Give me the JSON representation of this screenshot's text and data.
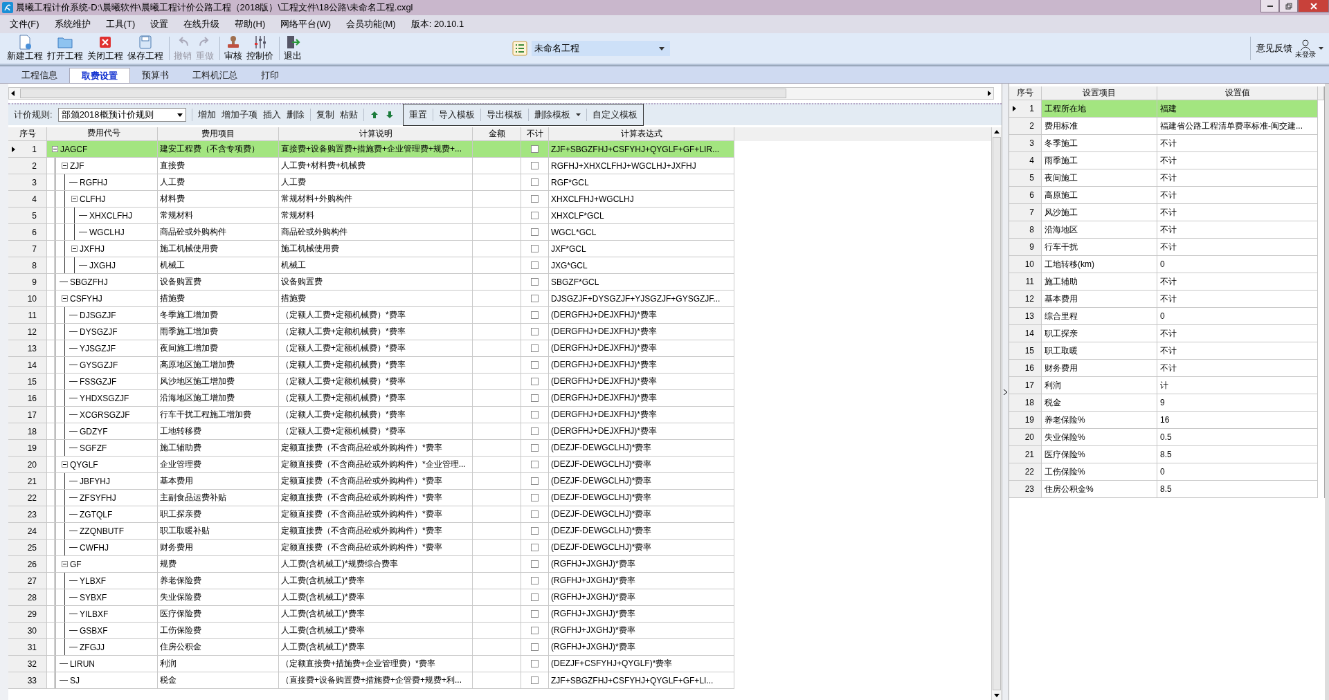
{
  "window": {
    "title": "晨曦工程计价系统-D:\\晨曦软件\\晨曦工程计价公路工程（2018版）\\工程文件\\18公路\\未命名工程.cxgl"
  },
  "menu": [
    "文件(F)",
    "系统维护",
    "工具(T)",
    "设置",
    "在线升级",
    "帮助(H)",
    "网络平台(W)",
    "会员功能(M)",
    "版本: 20.10.1"
  ],
  "toolbar": [
    {
      "label": "新建工程",
      "disabled": false
    },
    {
      "label": "打开工程",
      "disabled": false
    },
    {
      "label": "关闭工程",
      "disabled": false
    },
    {
      "label": "保存工程",
      "disabled": false
    },
    {
      "label": "撤销",
      "disabled": true
    },
    {
      "label": "重做",
      "disabled": true
    },
    {
      "label": "审核",
      "disabled": false
    },
    {
      "label": "控制价",
      "disabled": false
    },
    {
      "label": "退出",
      "disabled": false
    }
  ],
  "project_selector": {
    "value": "未命名工程"
  },
  "feedback": "意见反馈",
  "user": "未登录",
  "tabs": [
    {
      "label": "工程信息",
      "selected": false
    },
    {
      "label": "取费设置",
      "selected": true
    },
    {
      "label": "预算书",
      "selected": false
    },
    {
      "label": "工料机汇总",
      "selected": false
    },
    {
      "label": "打印",
      "selected": false
    }
  ],
  "rules_bar": {
    "label": "计价规则:",
    "rule": "部颁2018概预计价规则",
    "groups": [
      [
        {
          "label": "增加",
          "kind": "text"
        },
        {
          "label": "增加子项",
          "kind": "text"
        },
        {
          "label": "插入",
          "kind": "text"
        },
        {
          "label": "删除",
          "kind": "text"
        }
      ],
      [
        {
          "label": "复制",
          "kind": "text"
        },
        {
          "label": "粘贴",
          "kind": "text"
        }
      ],
      [
        {
          "kind": "up"
        },
        {
          "kind": "down"
        }
      ]
    ],
    "templates": [
      {
        "label": "重置",
        "kind": "text"
      },
      {
        "label": "导入模板",
        "kind": "text"
      },
      {
        "label": "导出模板",
        "kind": "text"
      },
      {
        "label": "删除模板",
        "kind": "dropdown"
      },
      {
        "label": "自定义模板",
        "kind": "text"
      }
    ]
  },
  "fee_table": {
    "columns": [
      "序号",
      "费用代号",
      "费用项目",
      "计算说明",
      "金额",
      "不计",
      "计算表达式"
    ],
    "rows": [
      {
        "no": "1",
        "code": "JAGCF",
        "item": "建安工程费（不含专项费）",
        "desc": "直接费+设备购置费+措施费+企业管理费+规费+...",
        "excluded": false,
        "expr": "ZJF+SBGZFHJ+CSFYHJ+QYGLF+GF+LIR...",
        "selected": true,
        "expanded": true,
        "children": [
          {
            "no": "2",
            "code": "ZJF",
            "item": "直接费",
            "desc": "人工费+材料费+机械费",
            "excluded": false,
            "expr": "RGFHJ+XHXCLFHJ+WGCLHJ+JXFHJ",
            "selected": false,
            "expanded": true,
            "children": [
              {
                "no": "3",
                "code": "RGFHJ",
                "item": "人工费",
                "desc": "人工费",
                "excluded": false,
                "expr": "RGF*GCL",
                "selected": false
              },
              {
                "no": "4",
                "code": "CLFHJ",
                "item": "材料费",
                "desc": "常规材料+外购构件",
                "excluded": false,
                "expr": "XHXCLFHJ+WGCLHJ",
                "selected": false,
                "expanded": true,
                "children": [
                  {
                    "no": "5",
                    "code": "XHXCLFHJ",
                    "item": "常规材料",
                    "desc": "常规材料",
                    "excluded": false,
                    "expr": "XHXCLF*GCL",
                    "selected": false
                  },
                  {
                    "no": "6",
                    "code": "WGCLHJ",
                    "item": "商品砼或外购构件",
                    "desc": "商品砼或外购构件",
                    "excluded": false,
                    "expr": "WGCL*GCL",
                    "selected": false
                  }
                ]
              },
              {
                "no": "7",
                "code": "JXFHJ",
                "item": "施工机械使用费",
                "desc": "施工机械使用费",
                "excluded": false,
                "expr": "JXF*GCL",
                "selected": false,
                "expanded": true,
                "children": [
                  {
                    "no": "8",
                    "code": "JXGHJ",
                    "item": "机械工",
                    "desc": "机械工",
                    "excluded": false,
                    "expr": "JXG*GCL",
                    "selected": false
                  }
                ]
              }
            ]
          },
          {
            "no": "9",
            "code": "SBGZFHJ",
            "item": "设备购置费",
            "desc": "设备购置费",
            "excluded": false,
            "expr": "SBGZF*GCL",
            "selected": false
          },
          {
            "no": "10",
            "code": "CSFYHJ",
            "item": "措施费",
            "desc": "措施费",
            "excluded": false,
            "expr": "DJSGZJF+DYSGZJF+YJSGZJF+GYSGZJF...",
            "selected": false,
            "expanded": true,
            "children": [
              {
                "no": "11",
                "code": "DJSGZJF",
                "item": "冬季施工增加费",
                "desc": "（定额人工费+定额机械费）*费率",
                "excluded": false,
                "expr": "(DERGFHJ+DEJXFHJ)*费率",
                "selected": false
              },
              {
                "no": "12",
                "code": "DYSGZJF",
                "item": "雨季施工增加费",
                "desc": "（定额人工费+定额机械费）*费率",
                "excluded": false,
                "expr": "(DERGFHJ+DEJXFHJ)*费率",
                "selected": false
              },
              {
                "no": "13",
                "code": "YJSGZJF",
                "item": "夜间施工增加费",
                "desc": "（定额人工费+定额机械费）*费率",
                "excluded": false,
                "expr": "(DERGFHJ+DEJXFHJ)*费率",
                "selected": false
              },
              {
                "no": "14",
                "code": "GYSGZJF",
                "item": "高原地区施工增加费",
                "desc": "（定额人工费+定额机械费）*费率",
                "excluded": false,
                "expr": "(DERGFHJ+DEJXFHJ)*费率",
                "selected": false
              },
              {
                "no": "15",
                "code": "FSSGZJF",
                "item": "风沙地区施工增加费",
                "desc": "（定额人工费+定额机械费）*费率",
                "excluded": false,
                "expr": "(DERGFHJ+DEJXFHJ)*费率",
                "selected": false
              },
              {
                "no": "16",
                "code": "YHDXSGZJF",
                "item": "沿海地区施工增加费",
                "desc": "（定额人工费+定额机械费）*费率",
                "excluded": false,
                "expr": "(DERGFHJ+DEJXFHJ)*费率",
                "selected": false
              },
              {
                "no": "17",
                "code": "XCGRSGZJF",
                "item": "行车干扰工程施工增加费",
                "desc": "（定额人工费+定额机械费）*费率",
                "excluded": false,
                "expr": "(DERGFHJ+DEJXFHJ)*费率",
                "selected": false
              },
              {
                "no": "18",
                "code": "GDZYF",
                "item": "工地转移费",
                "desc": "（定额人工费+定额机械费）*费率",
                "excluded": false,
                "expr": "(DERGFHJ+DEJXFHJ)*费率",
                "selected": false
              },
              {
                "no": "19",
                "code": "SGFZF",
                "item": "施工辅助费",
                "desc": "定额直接费（不含商品砼或外购构件）*费率",
                "excluded": false,
                "expr": "(DEZJF-DEWGCLHJ)*费率",
                "selected": false
              }
            ]
          },
          {
            "no": "20",
            "code": "QYGLF",
            "item": "企业管理费",
            "desc": "定额直接费（不含商品砼或外购构件）*企业管理...",
            "excluded": false,
            "expr": "(DEZJF-DEWGCLHJ)*费率",
            "selected": false,
            "expanded": true,
            "children": [
              {
                "no": "21",
                "code": "JBFYHJ",
                "item": "基本费用",
                "desc": "定额直接费（不含商品砼或外购构件）*费率",
                "excluded": false,
                "expr": "(DEZJF-DEWGCLHJ)*费率",
                "selected": false
              },
              {
                "no": "22",
                "code": "ZFSYFHJ",
                "item": "主副食品运费补贴",
                "desc": "定额直接费（不含商品砼或外购构件）*费率",
                "excluded": false,
                "expr": "(DEZJF-DEWGCLHJ)*费率",
                "selected": false
              },
              {
                "no": "23",
                "code": "ZGTQLF",
                "item": "职工探亲费",
                "desc": "定额直接费（不含商品砼或外购构件）*费率",
                "excluded": false,
                "expr": "(DEZJF-DEWGCLHJ)*费率",
                "selected": false
              },
              {
                "no": "24",
                "code": "ZZQNBUTF",
                "item": "职工取暖补贴",
                "desc": "定额直接费（不含商品砼或外购构件）*费率",
                "excluded": false,
                "expr": "(DEZJF-DEWGCLHJ)*费率",
                "selected": false
              },
              {
                "no": "25",
                "code": "CWFHJ",
                "item": "财务费用",
                "desc": "定额直接费（不含商品砼或外购构件）*费率",
                "excluded": false,
                "expr": "(DEZJF-DEWGCLHJ)*费率",
                "selected": false
              }
            ]
          },
          {
            "no": "26",
            "code": "GF",
            "item": "规费",
            "desc": "人工费(含机械工)*规费综合费率",
            "excluded": false,
            "expr": "(RGFHJ+JXGHJ)*费率",
            "selected": false,
            "expanded": true,
            "children": [
              {
                "no": "27",
                "code": "YLBXF",
                "item": "养老保险费",
                "desc": "人工费(含机械工)*费率",
                "excluded": false,
                "expr": "(RGFHJ+JXGHJ)*费率",
                "selected": false
              },
              {
                "no": "28",
                "code": "SYBXF",
                "item": "失业保险费",
                "desc": "人工费(含机械工)*费率",
                "excluded": false,
                "expr": "(RGFHJ+JXGHJ)*费率",
                "selected": false
              },
              {
                "no": "29",
                "code": "YILBXF",
                "item": "医疗保险费",
                "desc": "人工费(含机械工)*费率",
                "excluded": false,
                "expr": "(RGFHJ+JXGHJ)*费率",
                "selected": false
              },
              {
                "no": "30",
                "code": "GSBXF",
                "item": "工伤保险费",
                "desc": "人工费(含机械工)*费率",
                "excluded": false,
                "expr": "(RGFHJ+JXGHJ)*费率",
                "selected": false
              },
              {
                "no": "31",
                "code": "ZFGJJ",
                "item": "住房公积金",
                "desc": "人工费(含机械工)*费率",
                "excluded": false,
                "expr": "(RGFHJ+JXGHJ)*费率",
                "selected": false
              }
            ]
          },
          {
            "no": "32",
            "code": "LIRUN",
            "item": "利润",
            "desc": "（定额直接费+措施费+企业管理费）*费率",
            "excluded": false,
            "expr": "(DEZJF+CSFYHJ+QYGLF)*费率",
            "selected": false
          },
          {
            "no": "33",
            "code": "SJ",
            "item": "税金",
            "desc": "（直接费+设备购置费+措施费+企管费+规费+利...",
            "excluded": false,
            "expr": "ZJF+SBGZFHJ+CSFYHJ+QYGLF+GF+LI...",
            "selected": false
          }
        ]
      }
    ]
  },
  "settings_table": {
    "columns": [
      "序号",
      "设置项目",
      "设置值"
    ],
    "rows": [
      {
        "no": "1",
        "item": "工程所在地",
        "value": "福建",
        "selected": true
      },
      {
        "no": "2",
        "item": "费用标准",
        "value": "福建省公路工程清单费率标准-闽交建...",
        "selected": false
      },
      {
        "no": "3",
        "item": "冬季施工",
        "value": "不计",
        "selected": false
      },
      {
        "no": "4",
        "item": "雨季施工",
        "value": "不计",
        "selected": false
      },
      {
        "no": "5",
        "item": "夜间施工",
        "value": "不计",
        "selected": false
      },
      {
        "no": "6",
        "item": "高原施工",
        "value": "不计",
        "selected": false
      },
      {
        "no": "7",
        "item": "风沙施工",
        "value": "不计",
        "selected": false
      },
      {
        "no": "8",
        "item": "沿海地区",
        "value": "不计",
        "selected": false
      },
      {
        "no": "9",
        "item": "行车干扰",
        "value": "不计",
        "selected": false
      },
      {
        "no": "10",
        "item": "工地转移(km)",
        "value": "0",
        "selected": false
      },
      {
        "no": "11",
        "item": "施工辅助",
        "value": "不计",
        "selected": false
      },
      {
        "no": "12",
        "item": "基本费用",
        "value": "不计",
        "selected": false
      },
      {
        "no": "13",
        "item": "综合里程",
        "value": "0",
        "selected": false
      },
      {
        "no": "14",
        "item": "职工探亲",
        "value": "不计",
        "selected": false
      },
      {
        "no": "15",
        "item": "职工取暖",
        "value": "不计",
        "selected": false
      },
      {
        "no": "16",
        "item": "财务费用",
        "value": "不计",
        "selected": false
      },
      {
        "no": "17",
        "item": "利润",
        "value": "计",
        "selected": false
      },
      {
        "no": "18",
        "item": "税金",
        "value": "9",
        "selected": false
      },
      {
        "no": "19",
        "item": "养老保险%",
        "value": "16",
        "selected": false
      },
      {
        "no": "20",
        "item": "失业保险%",
        "value": "0.5",
        "selected": false
      },
      {
        "no": "21",
        "item": "医疗保险%",
        "value": "8.5",
        "selected": false
      },
      {
        "no": "22",
        "item": "工伤保险%",
        "value": "0",
        "selected": false
      },
      {
        "no": "23",
        "item": "住房公积金%",
        "value": "8.5",
        "selected": false
      }
    ]
  }
}
